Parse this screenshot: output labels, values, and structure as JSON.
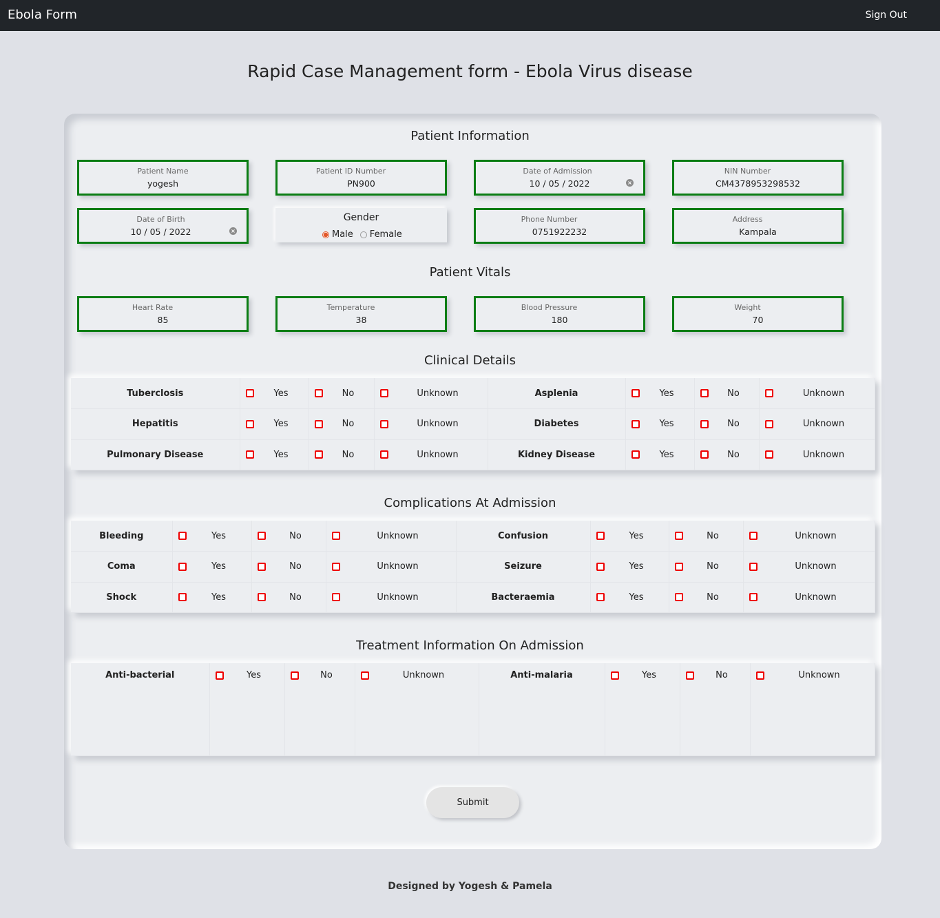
{
  "navbar": {
    "brand": "Ebola Form",
    "signout": "Sign Out"
  },
  "page_title": "Rapid Case Management form - Ebola Virus disease",
  "patient_info": {
    "title": "Patient Information",
    "patient_name": {
      "label": "Patient Name",
      "value": "yogesh"
    },
    "patient_id": {
      "label": "Patient ID Number",
      "value": "PN900"
    },
    "date_of_admission": {
      "label": "Date of Admission",
      "value": "10 / 05 / 2022"
    },
    "nin": {
      "label": "NIN Number",
      "value": "CM4378953298532"
    },
    "date_of_birth": {
      "label": "Date of Birth",
      "value": "10 / 05 / 2022"
    },
    "gender": {
      "label": "Gender",
      "male": "Male",
      "female": "Female",
      "selected": "Male"
    },
    "phone": {
      "label": "Phone Number",
      "value": "0751922232"
    },
    "address": {
      "label": "Address",
      "value": "Kampala"
    }
  },
  "vitals": {
    "title": "Patient Vitals",
    "heart_rate": {
      "label": "Heart Rate",
      "value": "85"
    },
    "temperature": {
      "label": "Temperature",
      "value": "38"
    },
    "blood_pressure": {
      "label": "Blood Pressure",
      "value": "180"
    },
    "weight": {
      "label": "Weight",
      "value": "70"
    }
  },
  "options": {
    "yes": "Yes",
    "no": "No",
    "unknown": "Unknown"
  },
  "clinical": {
    "title": "Clinical Details",
    "rows": [
      {
        "left": "Tuberclosis",
        "right": "Asplenia"
      },
      {
        "left": "Hepatitis",
        "right": "Diabetes"
      },
      {
        "left": "Pulmonary Disease",
        "right": "Kidney Disease"
      }
    ]
  },
  "complications": {
    "title": "Complications At Admission",
    "rows": [
      {
        "left": "Bleeding",
        "right": "Confusion"
      },
      {
        "left": "Coma",
        "right": "Seizure"
      },
      {
        "left": "Shock",
        "right": "Bacteraemia"
      }
    ]
  },
  "treatment": {
    "title": "Treatment Information On Admission",
    "rows": [
      {
        "left": "Anti-bacterial",
        "right": "Anti-malaria"
      }
    ]
  },
  "submit_label": "Submit",
  "footer": "Designed by Yogesh & Pamela",
  "colors": {
    "navbar": "#212529",
    "field_border": "#0b7d14",
    "checkbox": "#ee0000",
    "background": "#dfe1e7"
  }
}
